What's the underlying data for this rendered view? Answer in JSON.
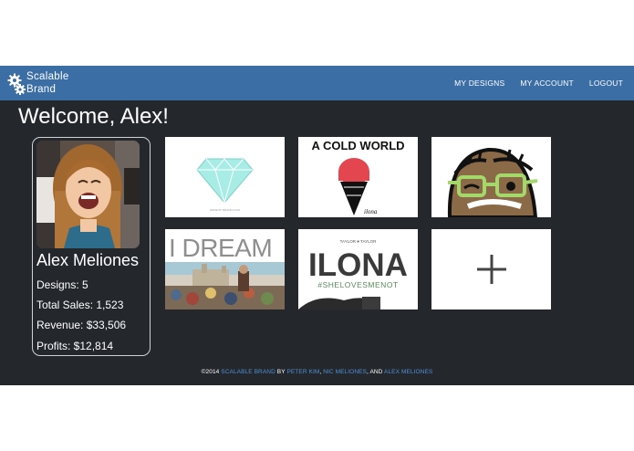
{
  "brand": {
    "line1": "Scalable",
    "line2": "Brand",
    "icon": "gears-icon"
  },
  "nav": {
    "items": [
      "MY DESIGNS",
      "MY ACCOUNT",
      "LOGOUT"
    ]
  },
  "welcome": "Welcome, Alex!",
  "profile": {
    "name": "Alex Meliones",
    "stats": [
      "Designs: 5",
      "Total Sales: 1,523",
      "Revenue: $33,506",
      "Profits: $12,814"
    ]
  },
  "designs": [
    {
      "name": "diamond-design",
      "caption": "MADE BY BRAND ICON"
    },
    {
      "name": "cold-world-design",
      "title": "A COLD WORLD",
      "sub": "ilona"
    },
    {
      "name": "glasses-face-design"
    },
    {
      "name": "i-dream-design",
      "title": "I DREAM"
    },
    {
      "name": "ilona-design",
      "top": "TAYLOR ♥ TAYLOR",
      "title": "ILONA",
      "hashtag": "#SHELOVESMENOT"
    }
  ],
  "add_tile": {
    "symbol": "+"
  },
  "footer": {
    "prefix": "©2014",
    "brand": "SCALABLE BRAND",
    "by": "BY",
    "author1": "PETER KIM",
    "sep": ",",
    "author2": "NIC MELIONES",
    "and": ", AND",
    "author3": "ALEX MELIONES"
  },
  "colors": {
    "navbar": "#3a6ea5",
    "background": "#24282d",
    "link": "#4f8fd6"
  }
}
